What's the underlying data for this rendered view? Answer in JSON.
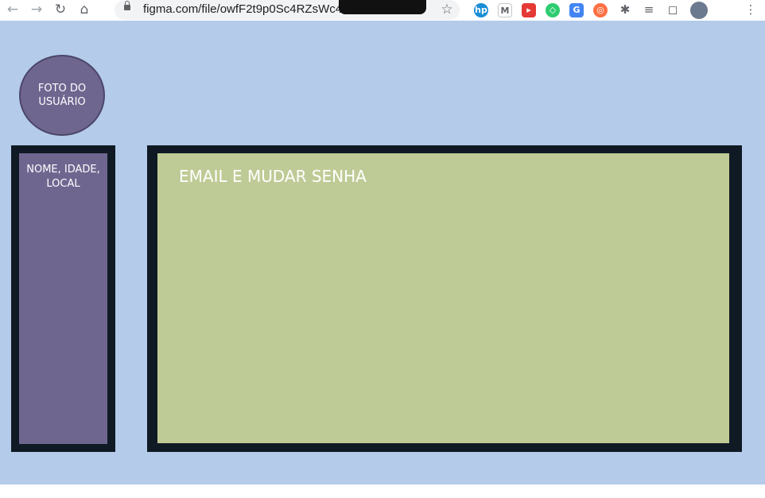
{
  "browser": {
    "url": "figma.com/file/owfF2t9p0Sc4RZsWc4"
  },
  "profile": {
    "photo_label": "FOTO DO USUÁRIO",
    "info_label": "NOME, IDADE, LOCAL"
  },
  "main": {
    "label": "EMAIL E MUDAR SENHA"
  },
  "colors": {
    "canvas": "#b4cbea",
    "frame": "#101a24",
    "profile": "#6f6690",
    "main_panel": "#bfcb96"
  }
}
